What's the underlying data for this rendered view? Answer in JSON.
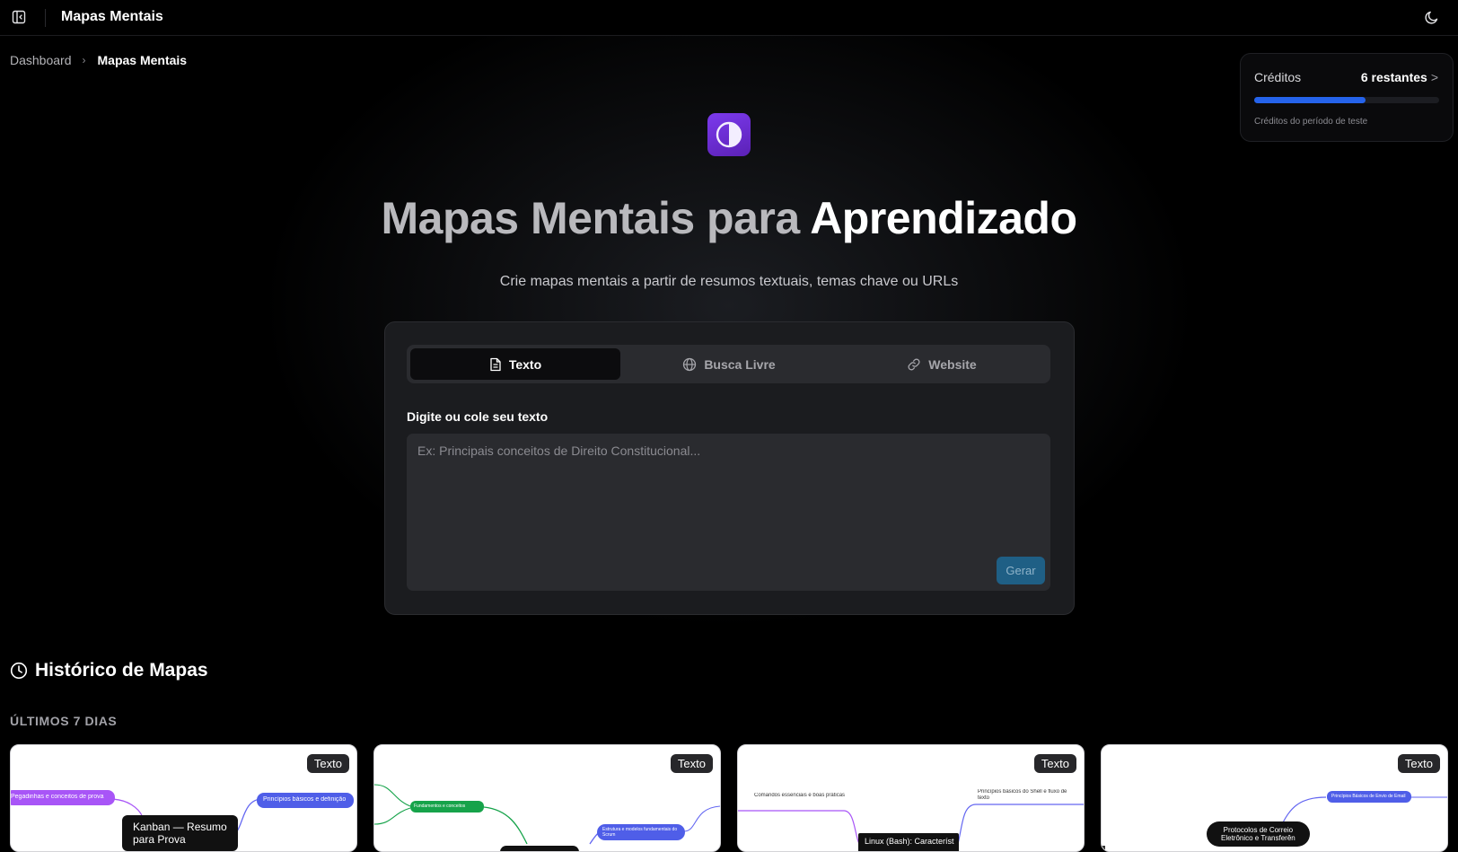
{
  "app": {
    "title": "Mapas Mentais"
  },
  "breadcrumb": {
    "items": [
      "Dashboard",
      "Mapas Mentais"
    ],
    "separator": "›"
  },
  "credits": {
    "label": "Créditos",
    "value": "6 restantes",
    "subtitle": "Créditos do período de teste",
    "progress_fraction": 0.6,
    "accent_color": "#2563eb"
  },
  "hero": {
    "logo_icon": "half-circle-icon",
    "title_part1": "Mapas Mentais para",
    "title_part2": "Aprendizado",
    "subtitle": "Crie mapas mentais a partir de resumos textuais, temas chave ou URLs"
  },
  "input_card": {
    "tabs": [
      {
        "label": "Texto",
        "icon": "document-icon",
        "active": true
      },
      {
        "label": "Busca Livre",
        "icon": "globe-icon",
        "active": false
      },
      {
        "label": "Website",
        "icon": "link-icon",
        "active": false
      }
    ],
    "field_label": "Digite ou cole seu texto",
    "placeholder": "Ex: Principais conceitos de Direito Constitucional...",
    "value": "",
    "submit_label": "Gerar"
  },
  "history": {
    "title": "Histórico de Mapas",
    "groups": [
      {
        "label": "ÚLTIMOS 7 DIAS",
        "maps": [
          {
            "badge": "Texto",
            "center": "Kanban — Resumo\npara Prova",
            "nodes": [
              "Pegadinhas e conceitos de prova",
              "Princípios básicos e definição"
            ]
          },
          {
            "badge": "Texto",
            "center": "",
            "nodes": [
              "Fundamentos e conceitos",
              "Estrutura e modelos fundamentais do Scrum"
            ]
          },
          {
            "badge": "Texto",
            "center": "Linux (Bash): Característ",
            "nodes": [
              "Comandos essenciais e boas práticas",
              "Princípios básicos do Shell e fluxo de texto"
            ]
          },
          {
            "badge": "Texto",
            "center": "Protocolos de Correio\nEletrônico e Transferên",
            "nodes": [
              "Princípios Básicos de Envio de Email"
            ]
          }
        ]
      }
    ]
  }
}
